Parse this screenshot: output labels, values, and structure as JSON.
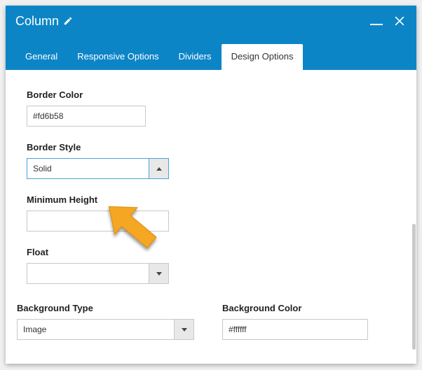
{
  "header": {
    "title": "Column"
  },
  "tabs": {
    "general": "General",
    "responsive": "Responsive Options",
    "dividers": "Dividers",
    "design": "Design Options"
  },
  "fields": {
    "border_color": {
      "label": "Border Color",
      "value": "#fd6b58"
    },
    "border_style": {
      "label": "Border Style",
      "value": "Solid"
    },
    "min_height": {
      "label": "Minimum Height",
      "value": ""
    },
    "float": {
      "label": "Float",
      "value": ""
    },
    "bg_type": {
      "label": "Background Type",
      "value": "Image"
    },
    "bg_color": {
      "label": "Background Color",
      "value": "#ffffff"
    }
  }
}
